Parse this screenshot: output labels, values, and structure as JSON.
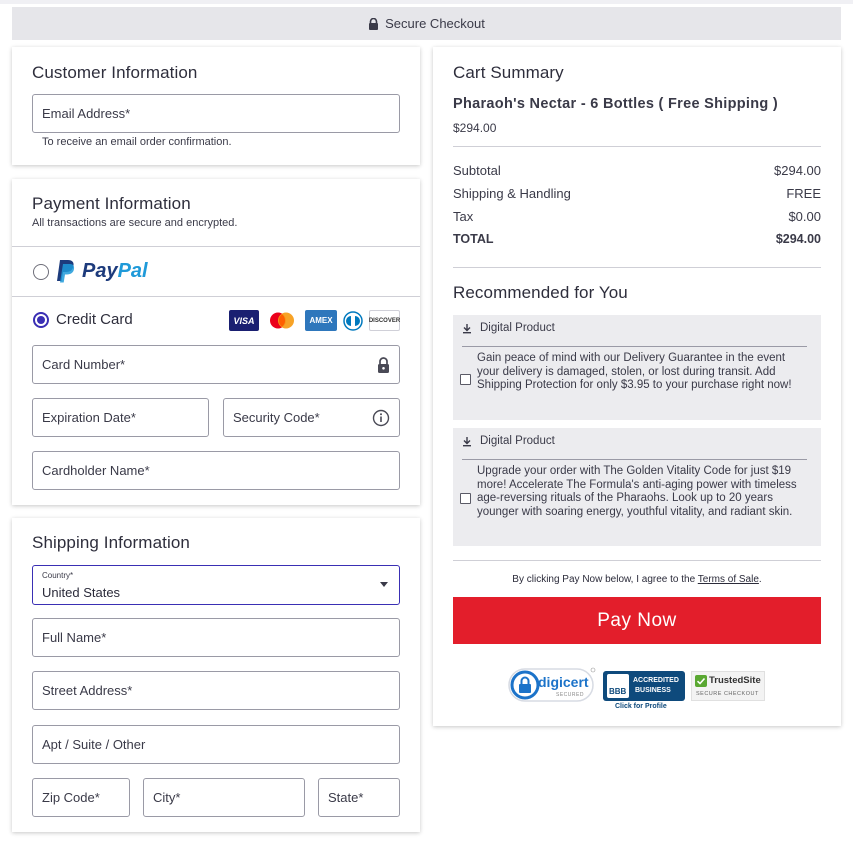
{
  "header": {
    "secure_label": "Secure Checkout"
  },
  "customer": {
    "title": "Customer Information",
    "email_placeholder": "Email Address*",
    "email_note": "To receive an email order confirmation."
  },
  "payment": {
    "title": "Payment Information",
    "subtitle": "All transactions are secure and encrypted.",
    "paypal_brand_1": "Pay",
    "paypal_brand_2": "Pal",
    "credit_card_label": "Credit Card",
    "selected_method": "Credit Card",
    "card_logos": [
      "VISA",
      "Mastercard",
      "AMEX",
      "Diners Club",
      "DISCOVER"
    ],
    "card_number_placeholder": "Card Number*",
    "expiration_placeholder": "Expiration Date*",
    "security_placeholder": "Security Code*",
    "cardholder_placeholder": "Cardholder Name*"
  },
  "shipping": {
    "title": "Shipping Information",
    "country_label": "Country*",
    "country_value": "United States",
    "full_name_placeholder": "Full Name*",
    "street_placeholder": "Street Address*",
    "apt_placeholder": "Apt / Suite / Other",
    "zip_placeholder": "Zip Code*",
    "city_placeholder": "City*",
    "state_placeholder": "State*"
  },
  "cart": {
    "title": "Cart Summary",
    "product_name": "Pharaoh's Nectar - 6 Bottles ( Free Shipping )",
    "product_price": "$294.00",
    "rows": [
      {
        "label": "Subtotal",
        "value": "$294.00"
      },
      {
        "label": "Shipping & Handling",
        "value": "FREE"
      },
      {
        "label": "Tax",
        "value": "$0.00"
      },
      {
        "label": "TOTAL",
        "value": "$294.00"
      }
    ],
    "recommended_title": "Recommended for You",
    "recommendations": [
      {
        "tag": "Digital Product",
        "text": "Gain peace of mind with our Delivery Guarantee in the event your delivery is damaged, stolen, or lost during transit. Add Shipping Protection for only $3.95 to your purchase right now!",
        "checked": false
      },
      {
        "tag": "Digital Product",
        "text": "Upgrade your order with The Golden Vitality Code for just $19 more! Accelerate The Formula's anti-aging power with timeless age-reversing rituals of the Pharaohs. Look up to 20 years younger with soaring energy, youthful vitality, and radiant skin.",
        "checked": false
      }
    ],
    "terms_prefix": "By clicking Pay Now below, I agree to the ",
    "terms_link": "Terms of Sale",
    "terms_suffix": ".",
    "pay_button": "Pay Now"
  },
  "trust_badges": {
    "digicert": "digicert",
    "digicert_sub": "SECURED",
    "bbb": "BBB",
    "bbb_line1": "ACCREDITED",
    "bbb_line2": "BUSINESS",
    "bbb_sub": "Click for Profile",
    "trustedsite": "TrustedSite",
    "trustedsite_sub": "SECURE CHECKOUT"
  },
  "colors": {
    "accent": "#3a2fb4",
    "pay_button": "#e31e2b",
    "paypal_dark": "#1d3b7c",
    "paypal_light": "#1f9ad9"
  }
}
